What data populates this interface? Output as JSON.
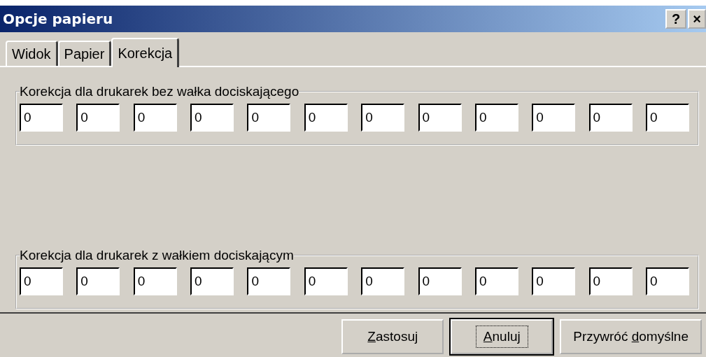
{
  "window": {
    "title": "Opcje papieru"
  },
  "title_buttons": [
    {
      "kind": "help",
      "label": "?"
    },
    {
      "kind": "close",
      "label": "×"
    }
  ],
  "tabs": [
    {
      "label": "Widok",
      "selected": false
    },
    {
      "label": "Papier",
      "selected": false
    },
    {
      "label": "Korekcja",
      "selected": true
    }
  ],
  "groups": [
    {
      "legend": "Korekcja dla drukarek bez wałka dociskającego",
      "fields": [
        "0",
        "0",
        "0",
        "0",
        "0",
        "0",
        "0",
        "0",
        "0",
        "0",
        "0",
        "0"
      ]
    },
    {
      "legend": "Korekcja dla drukarek z wałkiem dociskającym",
      "fields": [
        "0",
        "0",
        "0",
        "0",
        "0",
        "0",
        "0",
        "0",
        "0",
        "0",
        "0",
        "0"
      ]
    }
  ],
  "buttons": [
    {
      "key": "Z",
      "post": "astosuj",
      "focused": false
    },
    {
      "key": "A",
      "post": "nuluj",
      "focused": true
    },
    {
      "pre": "Przywróć ",
      "key": "d",
      "post": "omyślne",
      "focused": false
    }
  ]
}
